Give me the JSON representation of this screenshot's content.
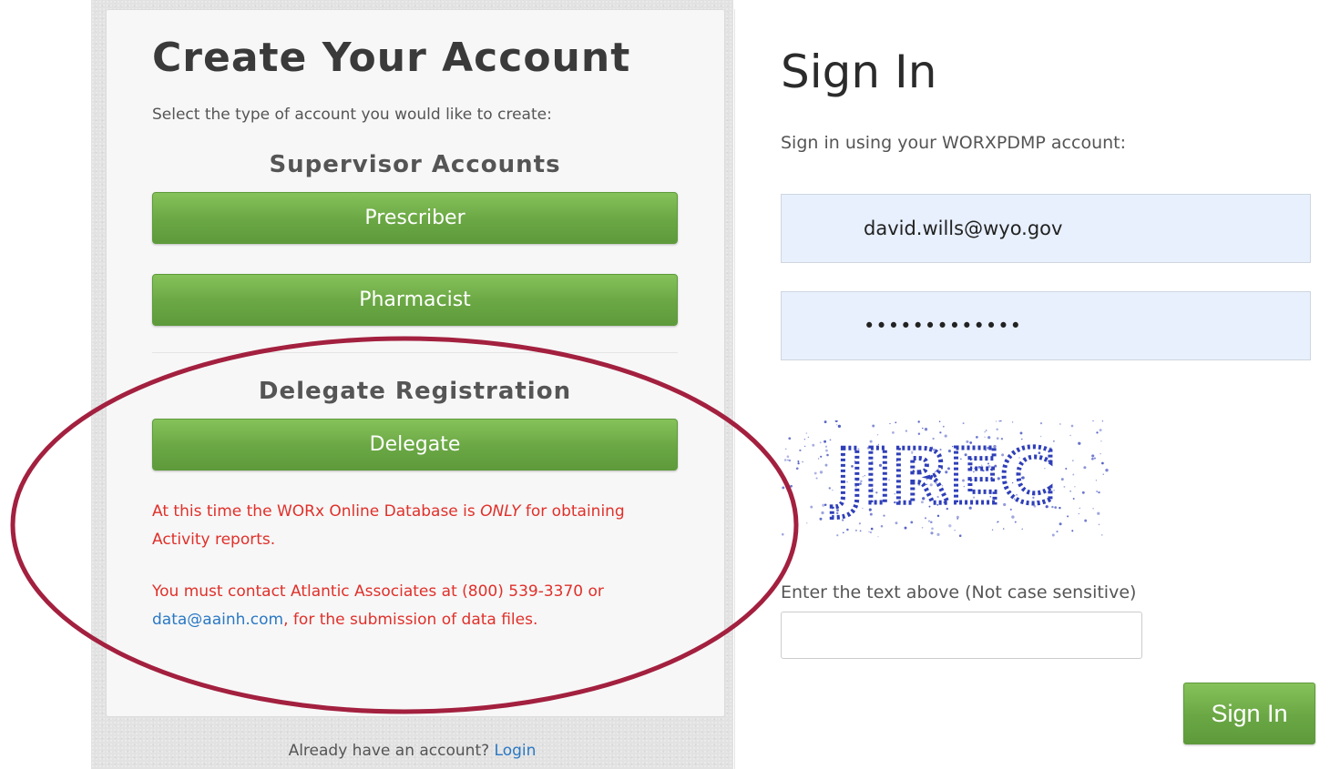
{
  "create_account": {
    "title": "Create Your Account",
    "subtitle": "Select the type of account you would like to create:",
    "supervisor_heading": "Supervisor Accounts",
    "prescriber_label": "Prescriber",
    "pharmacist_label": "Pharmacist",
    "delegate_heading": "Delegate Registration",
    "delegate_label": "Delegate",
    "notice1_pre": "At this time the WORx Online Database is ",
    "notice1_em": "ONLY",
    "notice1_post": " for obtaining Activity reports.",
    "notice2_pre": "You must contact Atlantic Associates at (800) 539-3370 or ",
    "notice2_link": "data@aainh.com",
    "notice2_post": ", for the submission of data files.",
    "login_prompt": "Already have an account?",
    "login_link": "Login"
  },
  "sign_in": {
    "title": "Sign In",
    "subtitle": "Sign in using your WORXPDMP account:",
    "email_value": "david.wills@wyo.gov",
    "password_mask": "•••••••••••••",
    "captcha_text": "JIREC",
    "captcha_label": "Enter the text above (Not case sensitive)",
    "captcha_value": "",
    "button_label": "Sign In"
  },
  "colors": {
    "button_green": "#6aa744",
    "notice_red": "#e0302a",
    "link_blue": "#2a78c4",
    "highlight_ellipse": "#a3203f",
    "captcha_blue": "#2f3fb8"
  }
}
